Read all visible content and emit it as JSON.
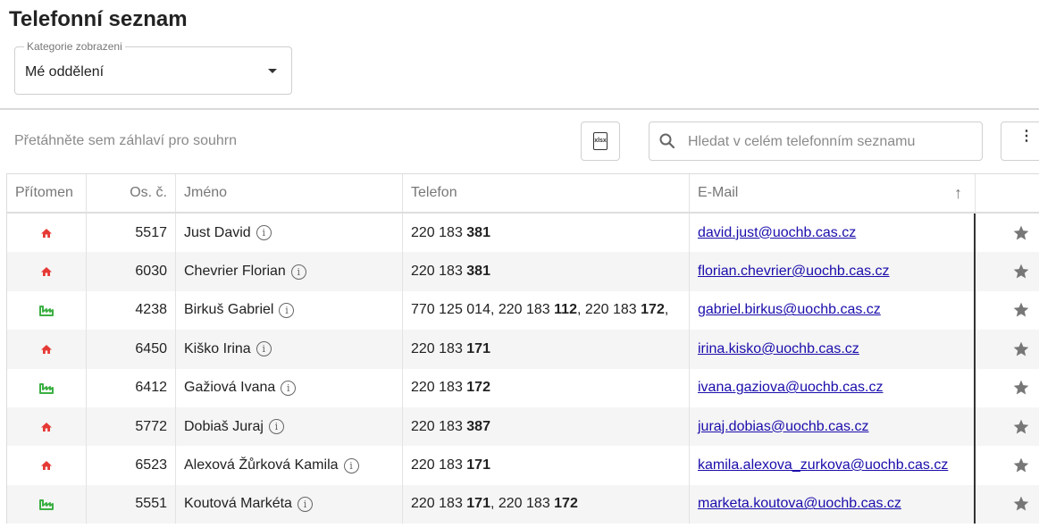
{
  "page": {
    "title": "Telefonní seznam",
    "category": {
      "label": "Kategorie zobrazeni",
      "value": "Mé oddělení"
    }
  },
  "toolbar": {
    "group_hint": "Přetáhněte sem záhlaví pro souhrn",
    "export_icon": "xlsx-export-icon",
    "export_text": "xlsx",
    "search_placeholder": "Hledat v celém telefonním seznamu",
    "more_icon": "more-vertical-icon",
    "more_symbol": "⋮"
  },
  "table": {
    "columns": {
      "present": "Přítomen",
      "id": "Os. č.",
      "name": "Jméno",
      "phone": "Telefon",
      "email": "E-Mail",
      "sort_symbol": "↑"
    },
    "info_symbol": "i",
    "status_colors": {
      "home": "#e53935",
      "office": "#3cb043"
    },
    "rows": [
      {
        "status": "home",
        "id": "5517",
        "name": "Just David",
        "phone": [
          {
            "p": "220 183 ",
            "b": "381"
          }
        ],
        "email": "david.just@uochb.cas.cz"
      },
      {
        "status": "home",
        "id": "6030",
        "name": "Chevrier Florian",
        "phone": [
          {
            "p": "220 183 ",
            "b": "381"
          }
        ],
        "email": "florian.chevrier@uochb.cas.cz"
      },
      {
        "status": "office",
        "id": "4238",
        "name": "Birkuš Gabriel",
        "phone": [
          {
            "p": "770 125 014, 220 183 ",
            "b": "112"
          },
          {
            "p": ", 220 183 ",
            "b": "172"
          },
          {
            "p": ",",
            "b": ""
          }
        ],
        "email": "gabriel.birkus@uochb.cas.cz"
      },
      {
        "status": "home",
        "id": "6450",
        "name": "Kiško Irina",
        "phone": [
          {
            "p": "220 183 ",
            "b": "171"
          }
        ],
        "email": "irina.kisko@uochb.cas.cz"
      },
      {
        "status": "office",
        "id": "6412",
        "name": "Gažiová Ivana",
        "phone": [
          {
            "p": "220 183 ",
            "b": "172"
          }
        ],
        "email": "ivana.gaziova@uochb.cas.cz"
      },
      {
        "status": "home",
        "id": "5772",
        "name": "Dobiaš Juraj",
        "phone": [
          {
            "p": "220 183 ",
            "b": "387"
          }
        ],
        "email": "juraj.dobias@uochb.cas.cz"
      },
      {
        "status": "home",
        "id": "6523",
        "name": "Alexová Žůrková Kamila",
        "phone": [
          {
            "p": "220 183 ",
            "b": "171"
          }
        ],
        "email": "kamila.alexova_zurkova@uochb.cas.cz"
      },
      {
        "status": "office",
        "id": "5551",
        "name": "Koutová Markéta",
        "phone": [
          {
            "p": "220 183 ",
            "b": "171"
          },
          {
            "p": ", 220 183 ",
            "b": "172"
          }
        ],
        "email": "marketa.koutova@uochb.cas.cz"
      }
    ]
  }
}
